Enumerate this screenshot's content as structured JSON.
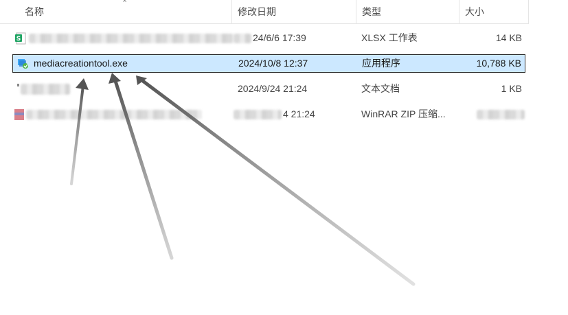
{
  "columns": {
    "name": "名称",
    "date": "修改日期",
    "type": "类型",
    "size": "大小"
  },
  "rows": [
    {
      "name": "",
      "date": "24/6/6 17:39",
      "type": "XLSX 工作表",
      "size": "14 KB",
      "icon": "xlsx-file-icon"
    },
    {
      "name": "mediacreationtool.exe",
      "date": "2024/10/8 12:37",
      "type": "应用程序",
      "size": "10,788 KB",
      "icon": "media-creation-tool-icon"
    },
    {
      "name": "",
      "date": "2024/9/24 21:24",
      "type": "文本文档",
      "size": "1 KB",
      "icon": "text-file-icon"
    },
    {
      "name": "",
      "date": "4 21:24",
      "type": "WinRAR ZIP 压缩...",
      "size": "",
      "icon": "zip-archive-icon"
    }
  ],
  "colors": {
    "selection": "#cce8ff",
    "arrow": "#555555"
  }
}
